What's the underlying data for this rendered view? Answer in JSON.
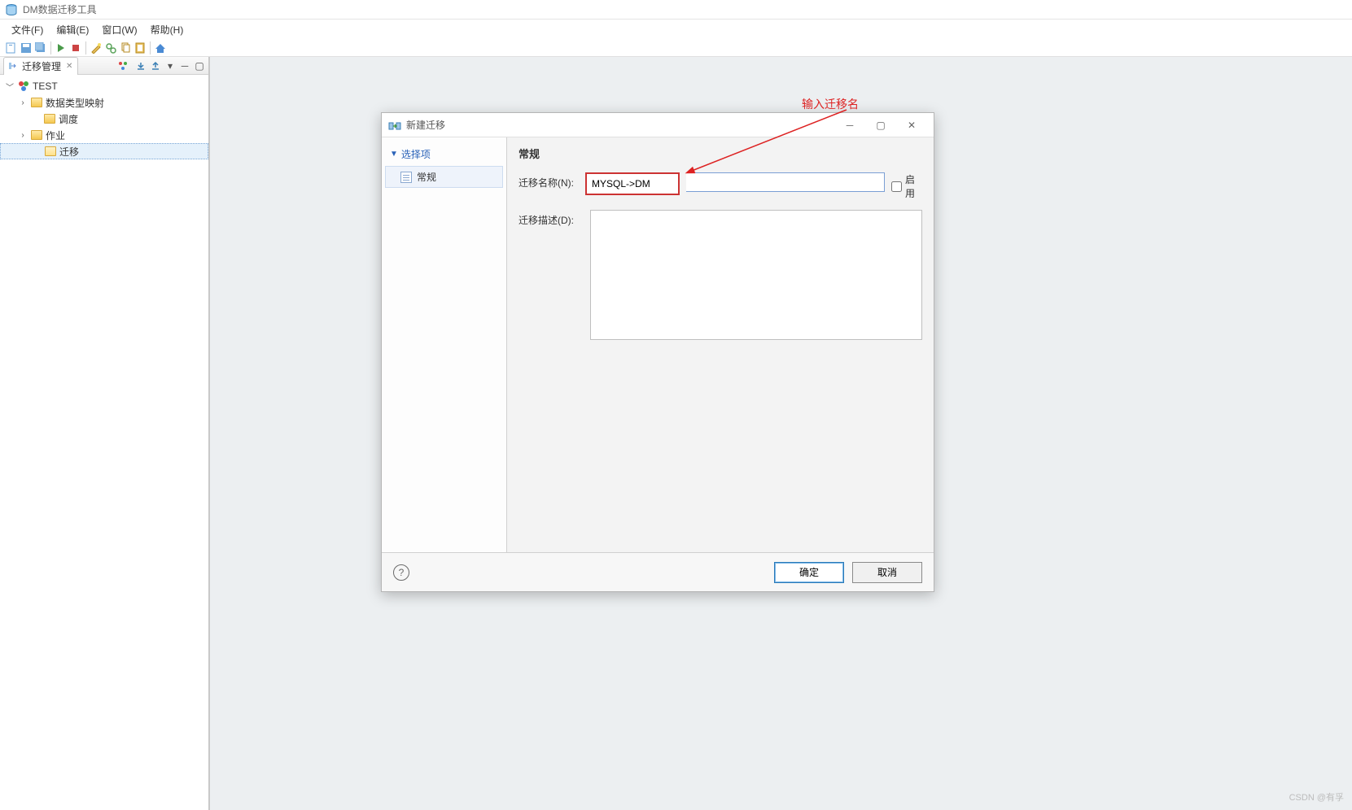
{
  "app": {
    "title": "DM数据迁移工具"
  },
  "menu": {
    "file": "文件(F)",
    "edit": "编辑(E)",
    "window": "窗口(W)",
    "help": "帮助(H)"
  },
  "panel": {
    "title": "迁移管理"
  },
  "tree": {
    "root": "TEST",
    "nodes": {
      "mapping": "数据类型映射",
      "schedule": "调度",
      "job": "作业",
      "migration": "迁移"
    }
  },
  "dialog": {
    "title": "新建迁移",
    "nav_header": "选择项",
    "nav_item": "常规",
    "section_title": "常规",
    "name_label": "迁移名称(N):",
    "name_value": "MYSQL->DM",
    "desc_label": "迁移描述(D):",
    "desc_value": "",
    "enable_label": "启用",
    "ok": "确定",
    "cancel": "取消"
  },
  "annotation": {
    "text": "输入迁移名"
  },
  "watermark": "CSDN @有孚"
}
